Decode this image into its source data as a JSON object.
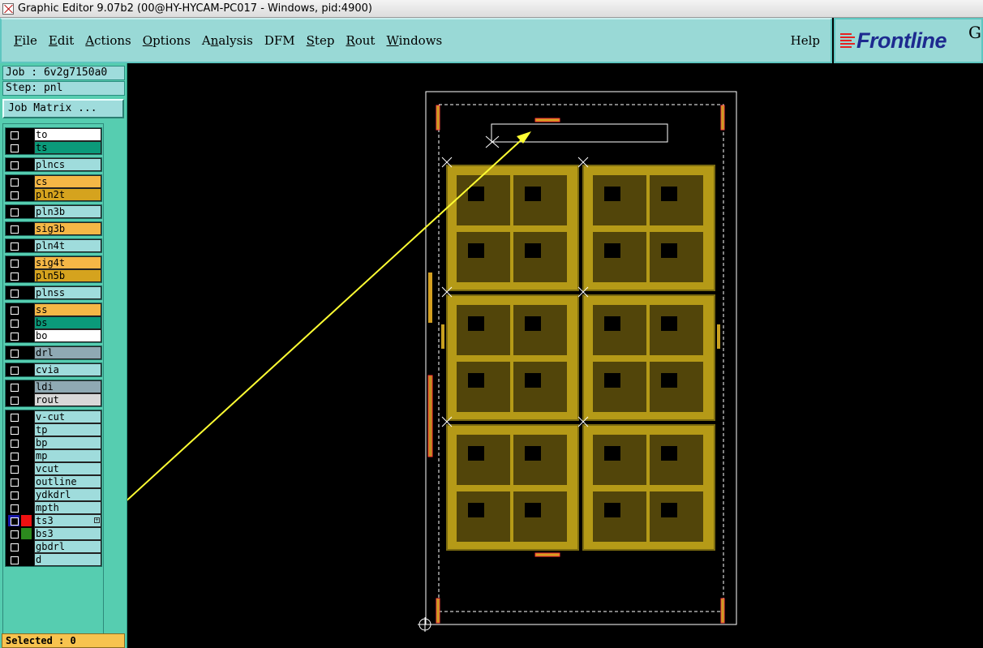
{
  "window": {
    "title": "Graphic Editor 9.07b2 (00@HY-HYCAM-PC017 - Windows, pid:4900)"
  },
  "menu": {
    "items": [
      {
        "pre": "",
        "ul": "F",
        "post": "ile"
      },
      {
        "pre": "",
        "ul": "E",
        "post": "dit"
      },
      {
        "pre": "",
        "ul": "A",
        "post": "ctions"
      },
      {
        "pre": "",
        "ul": "O",
        "post": "ptions"
      },
      {
        "pre": "A",
        "ul": "n",
        "post": "alysis"
      },
      {
        "pre": "DFM",
        "ul": "",
        "post": ""
      },
      {
        "pre": "",
        "ul": "S",
        "post": "tep"
      },
      {
        "pre": "",
        "ul": "R",
        "post": "out"
      },
      {
        "pre": "",
        "ul": "W",
        "post": "indows"
      }
    ],
    "help": "Help"
  },
  "brand": {
    "logo": "Frontline",
    "suffix": "G"
  },
  "job": {
    "job_text": "Job : 6v2g7150a0",
    "step_text": "Step: pnl",
    "matrix_button": "Job Matrix ..."
  },
  "layers": {
    "groups": [
      [
        {
          "name": "to",
          "bg": "#ffffff",
          "selected": false,
          "swatch": ""
        },
        {
          "name": "ts",
          "bg": "#0b9a7a",
          "selected": false,
          "swatch": ""
        }
      ],
      [
        {
          "name": "plncs",
          "bg": "#9fdcdc",
          "selected": false,
          "swatch": ""
        }
      ],
      [
        {
          "name": "cs",
          "bg": "#f5b746",
          "selected": false,
          "swatch": ""
        },
        {
          "name": "pln2t",
          "bg": "#d5a31e",
          "selected": false,
          "swatch": ""
        }
      ],
      [
        {
          "name": "pln3b",
          "bg": "#9fdcdc",
          "selected": false,
          "swatch": ""
        }
      ],
      [
        {
          "name": "sig3b",
          "bg": "#f5b746",
          "selected": false,
          "swatch": ""
        }
      ],
      [
        {
          "name": "pln4t",
          "bg": "#9fdcdc",
          "selected": false,
          "swatch": ""
        }
      ],
      [
        {
          "name": "sig4t",
          "bg": "#f5b746",
          "selected": false,
          "swatch": ""
        },
        {
          "name": "pln5b",
          "bg": "#d5a31e",
          "selected": false,
          "swatch": ""
        }
      ],
      [
        {
          "name": "plnss",
          "bg": "#9fdcdc",
          "selected": false,
          "swatch": ""
        }
      ],
      [
        {
          "name": "ss",
          "bg": "#f5b746",
          "selected": false,
          "swatch": ""
        },
        {
          "name": "bs",
          "bg": "#0b9a7a",
          "selected": false,
          "swatch": ""
        },
        {
          "name": "bo",
          "bg": "#ffffff",
          "selected": false,
          "swatch": ""
        }
      ],
      [
        {
          "name": "drl",
          "bg": "#8fa9b3",
          "selected": false,
          "swatch": ""
        }
      ],
      [
        {
          "name": "cvia",
          "bg": "#9fdcdc",
          "selected": false,
          "swatch": ""
        }
      ],
      [
        {
          "name": "ldi",
          "bg": "#8fa9b3",
          "selected": false,
          "swatch": ""
        },
        {
          "name": "rout",
          "bg": "#d8d8d8",
          "selected": false,
          "swatch": ""
        }
      ],
      [
        {
          "name": "v-cut",
          "bg": "#9fdcdc",
          "selected": false,
          "swatch": ""
        },
        {
          "name": "tp",
          "bg": "#9fdcdc",
          "selected": false,
          "swatch": ""
        },
        {
          "name": "bp",
          "bg": "#9fdcdc",
          "selected": false,
          "swatch": ""
        },
        {
          "name": "mp",
          "bg": "#9fdcdc",
          "selected": false,
          "swatch": ""
        },
        {
          "name": "vcut",
          "bg": "#9fdcdc",
          "selected": false,
          "swatch": ""
        },
        {
          "name": "outline",
          "bg": "#9fdcdc",
          "selected": false,
          "swatch": ""
        },
        {
          "name": "ydkdrl",
          "bg": "#9fdcdc",
          "selected": false,
          "swatch": ""
        },
        {
          "name": "mpth",
          "bg": "#9fdcdc",
          "selected": false,
          "swatch": ""
        },
        {
          "name": "ts3",
          "bg": "#9fdcdc",
          "selected": true,
          "swatch": "#ee1111"
        },
        {
          "name": "bs3",
          "bg": "#9fdcdc",
          "selected": false,
          "swatch": "#2c8a1e"
        },
        {
          "name": "gbdrl",
          "bg": "#9fdcdc",
          "selected": false,
          "swatch": ""
        },
        {
          "name": "d",
          "bg": "#9fdcdc",
          "selected": false,
          "swatch": ""
        }
      ]
    ]
  },
  "status": {
    "selected": "Selected : 0"
  },
  "colors": {
    "panel_bg": "#56cdb0",
    "menu_bg": "#99d9d6",
    "board_gold": "#b59a17",
    "annotation_arrow": "#ffff33"
  }
}
